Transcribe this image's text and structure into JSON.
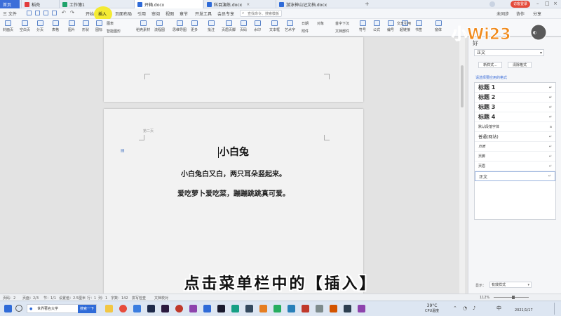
{
  "tabs": [
    {
      "label": "首页",
      "color": "#3c6ed9"
    },
    {
      "label": "稻壳",
      "color": "#e23b3b"
    },
    {
      "label": "工作簿1",
      "color": "#1fa36b"
    },
    {
      "label": "开箱.docx",
      "color": "#2f6bd8"
    },
    {
      "label": "科目演练.docx",
      "color": "#2f6bd8"
    },
    {
      "label": "游泳神山记文档.docx",
      "color": "#2f6bd8"
    }
  ],
  "window_user": "访客登录",
  "menu": {
    "file": "三 文件",
    "items": [
      "开始",
      "插入",
      "页面布局",
      "引用",
      "审阅",
      "视图",
      "章节",
      "开发工具",
      "会员专享"
    ],
    "search": "查找命令、搜索模板",
    "right": [
      "未同步",
      "协作",
      "分享"
    ]
  },
  "toolbar": [
    "封面页",
    "空白页",
    "分页",
    "表格",
    "图片",
    "形状",
    "图标",
    "智能图形",
    "稻壳素材",
    "流程图",
    "思维导图",
    "更多",
    "批注",
    "页眉页脚",
    "页码",
    "水印",
    "文本框",
    "艺术字",
    "日期",
    "附件",
    "对象",
    "首字下沉",
    "文档部件",
    "符号",
    "公式",
    "编号",
    "超链接",
    "书签",
    "窗体"
  ],
  "toolbar_extra": {
    "screenshot": "截屏",
    "chart": "图表",
    "cross_ref": "交叉引用"
  },
  "document": {
    "header_hint": "第二页",
    "title": "小白兔",
    "line1": "小白兔白又白，两只耳朵竖起来。",
    "line2": "爱吃萝卜爱吃菜，蹦蹦跳跳真可爱。"
  },
  "panel": {
    "head_left": "好",
    "head_mid": "正文",
    "current_style": "正文",
    "new_style": "新样式...",
    "clear_format": "清除格式",
    "hint": "请选择要应用的格式",
    "styles": [
      {
        "label": "标题 1",
        "mark": "↵"
      },
      {
        "label": "标题 2",
        "mark": "↵"
      },
      {
        "label": "标题 3",
        "mark": "↵"
      },
      {
        "label": "标题 4",
        "mark": "↵"
      },
      {
        "label": "默认段落字体",
        "mark": "a"
      },
      {
        "label": "普通(网站)",
        "mark": "↵"
      },
      {
        "label": "页眉",
        "mark": "↵"
      },
      {
        "label": "页脚",
        "mark": "↵"
      },
      {
        "label": "页眉",
        "mark": "↵"
      },
      {
        "label": "正文",
        "mark": "↵"
      }
    ],
    "show_label": "显示：",
    "show_value": "有效样式"
  },
  "logo": {
    "text": "小Wi23"
  },
  "status": {
    "page_num": "页码：2",
    "pages": "页面：2/3",
    "section": "节：1/1",
    "setting": "设置值：2.5厘米",
    "row": "行：1",
    "col": "列：1",
    "words": "字数：142",
    "spell": "拼写检查",
    "doc_check": "文档校对",
    "zoom": "112%"
  },
  "taskbar": {
    "app_label": "世界著名大学",
    "search_label": "搜索一下",
    "weather_temp": "39°C",
    "weather_desc": "CPU温度",
    "clock": "2021/1/17",
    "lang": "中"
  },
  "subtitle": "点击菜单栏中的【插入】"
}
